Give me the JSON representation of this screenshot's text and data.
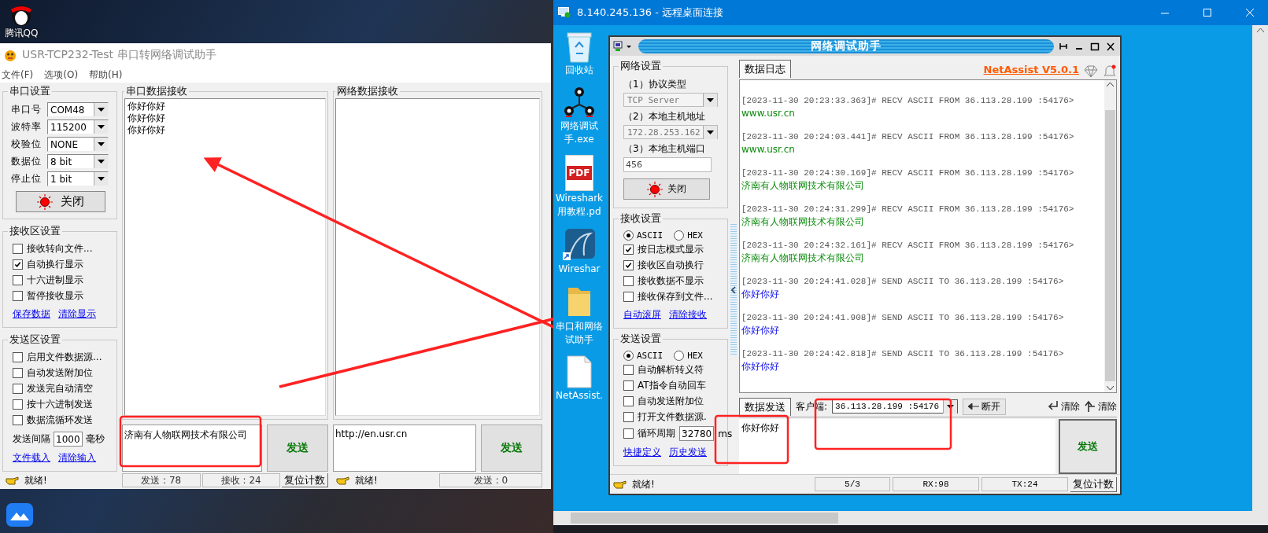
{
  "desktop": {
    "icons": [
      {
        "label": "腾讯QQ"
      }
    ]
  },
  "serial_window": {
    "title": "USR-TCP232-Test 串口转网络调试助手",
    "menu": [
      "文件(F)",
      "选项(O)",
      "帮助(H)"
    ],
    "port_settings": {
      "title": "串口设置",
      "fields": [
        {
          "label": "串口号",
          "value": "COM48"
        },
        {
          "label": "波特率",
          "value": "115200"
        },
        {
          "label": "校验位",
          "value": "NONE"
        },
        {
          "label": "数据位",
          "value": "8 bit"
        },
        {
          "label": "停止位",
          "value": "1 bit"
        }
      ],
      "button": "关闭"
    },
    "receive_settings": {
      "title": "接收区设置",
      "options": [
        {
          "label": "接收转向文件...",
          "checked": false
        },
        {
          "label": "自动换行显示",
          "checked": true
        },
        {
          "label": "十六进制显示",
          "checked": false
        },
        {
          "label": "暂停接收显示",
          "checked": false
        }
      ],
      "links": [
        "保存数据",
        "清除显示"
      ]
    },
    "send_settings": {
      "title": "发送区设置",
      "options": [
        {
          "label": "启用文件数据源...",
          "checked": false
        },
        {
          "label": "自动发送附加位",
          "checked": false
        },
        {
          "label": "发送完自动清空",
          "checked": false
        },
        {
          "label": "按十六进制发送",
          "checked": false
        },
        {
          "label": "数据流循环发送",
          "checked": false
        }
      ],
      "interval": {
        "label": "发送间隔",
        "value": "1000",
        "unit": "毫秒"
      },
      "links": [
        "文件载入",
        "清除输入"
      ]
    },
    "serial_receive": {
      "title": "串口数据接收",
      "lines": [
        "你好你好",
        "你好你好",
        "你好你好"
      ],
      "send_text": "济南有人物联网技术有限公司",
      "send_button": "发送"
    },
    "network_receive": {
      "title": "网络数据接收",
      "send_text": "http://en.usr.cn",
      "send_button": "发送"
    },
    "status_bar": {
      "serial_status": "就绪!",
      "sent": "发送 : 78",
      "received": "接收 : 24",
      "reset": "复位计数",
      "network_status": "就绪!",
      "network_sent": "发送 : 0"
    }
  },
  "remote_window": {
    "title": "8.140.245.136 - 远程桌面连接",
    "desktop_icons": [
      {
        "kind": "recycle",
        "lines": [
          "回收站"
        ]
      },
      {
        "kind": "network",
        "lines": [
          "网络调试",
          "手.exe"
        ]
      },
      {
        "kind": "pdf",
        "badge": "PDF",
        "lines": [
          "Wireshark",
          "用教程.pd"
        ]
      },
      {
        "kind": "shark",
        "lines": [
          "Wireshar"
        ]
      },
      {
        "kind": "folder",
        "lines": [
          "串口和网络",
          "试助手"
        ]
      },
      {
        "kind": "file",
        "lines": [
          "NetAssist."
        ]
      }
    ],
    "netassist": {
      "title": "网络调试助手",
      "network_settings": {
        "title": "网络设置",
        "fields": [
          {
            "kind": "select",
            "label": "（1）协议类型",
            "value": "TCP Server"
          },
          {
            "kind": "select",
            "label": "（2）本地主机地址",
            "value": "172.28.253.162"
          },
          {
            "kind": "input",
            "label": "（3）本地主机端口",
            "value": "456"
          }
        ],
        "button": "关闭"
      },
      "receive_settings": {
        "title": "接收设置",
        "modes": [
          {
            "label": "ASCII",
            "selected": true
          },
          {
            "label": "HEX",
            "selected": false
          }
        ],
        "options": [
          {
            "label": "按日志模式显示",
            "checked": true
          },
          {
            "label": "接收区自动换行",
            "checked": true
          },
          {
            "label": "接收数据不显示",
            "checked": false
          },
          {
            "label": "接收保存到文件...",
            "checked": false
          }
        ],
        "links": [
          "自动滚屏",
          "清除接收"
        ]
      },
      "send_settings": {
        "title": "发送设置",
        "modes": [
          {
            "label": "ASCII",
            "selected": true
          },
          {
            "label": "HEX",
            "selected": false
          }
        ],
        "options": [
          {
            "label": "自动解析转义符",
            "checked": false
          },
          {
            "label": "AT指令自动回车",
            "checked": false
          },
          {
            "label": "自动发送附加位",
            "checked": false
          },
          {
            "label": "打开文件数据源.",
            "checked": false
          }
        ],
        "cycle": {
          "label": "循环周期",
          "checked": false,
          "value": "32780",
          "unit": "ms"
        },
        "links": [
          "快捷定义",
          "历史发送"
        ]
      },
      "log_tab": {
        "label": "数据日志",
        "selected": true
      },
      "version": "NetAssist V5.0.1",
      "log": [
        {
          "kind": "recv",
          "header": "[2023-11-30 20:23:33.363]# RECV ASCII FROM 36.113.28.199 :54176>",
          "body": "www.usr.cn"
        },
        {
          "kind": "recv",
          "header": "[2023-11-30 20:24:03.441]# RECV ASCII FROM 36.113.28.199 :54176>",
          "body": "www.usr.cn"
        },
        {
          "kind": "recv",
          "header": "[2023-11-30 20:24:30.169]# RECV ASCII FROM 36.113.28.199 :54176>",
          "body": "济南有人物联网技术有限公司"
        },
        {
          "kind": "recv",
          "header": "[2023-11-30 20:24:31.299]# RECV ASCII FROM 36.113.28.199 :54176>",
          "body": "济南有人物联网技术有限公司"
        },
        {
          "kind": "recv",
          "header": "[2023-11-30 20:24:32.161]# RECV ASCII FROM 36.113.28.199 :54176>",
          "body": "济南有人物联网技术有限公司"
        },
        {
          "kind": "send",
          "header": "[2023-11-30 20:24:41.028]# SEND ASCII TO 36.113.28.199 :54176>",
          "body": "你好你好"
        },
        {
          "kind": "send",
          "header": "[2023-11-30 20:24:41.908]# SEND ASCII TO 36.113.28.199 :54176>",
          "body": "你好你好"
        },
        {
          "kind": "send",
          "header": "[2023-11-30 20:24:42.818]# SEND ASCII TO 36.113.28.199 :54176>",
          "body": "你好你好"
        }
      ],
      "send_tab": {
        "label": "数据发送",
        "selected": true
      },
      "client_label": "客户端:",
      "client_value": "36.113.28.199 :54176",
      "disconnect": "断开",
      "clear_buttons": [
        "清除",
        "清除"
      ],
      "send_text": "你好你好",
      "send_button": "发送",
      "status_bar": {
        "status": "就绪!",
        "counts": "5/3",
        "rx": "RX:98",
        "tx": "TX:24",
        "reset": "复位计数"
      }
    }
  }
}
